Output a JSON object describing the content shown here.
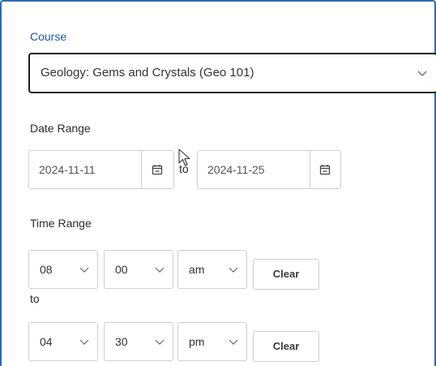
{
  "course": {
    "label": "Course",
    "selected": "Geology: Gems and Crystals (Geo 101)"
  },
  "date_range": {
    "label": "Date Range",
    "start": "2024-11-11",
    "separator": "to",
    "end": "2024-11-25"
  },
  "time_range": {
    "label": "Time Range",
    "start": {
      "hour": "08",
      "minute": "00",
      "period": "am",
      "clear_label": "Clear"
    },
    "separator": "to",
    "end": {
      "hour": "04",
      "minute": "30",
      "period": "pm",
      "clear_label": "Clear"
    }
  },
  "colors": {
    "accent": "#2a6ab8",
    "label_accent": "#2255a4",
    "border": "#d0d0d0"
  },
  "icons": {
    "course_dropdown": "chevron-down-icon",
    "date_picker": "calendar-icon"
  }
}
